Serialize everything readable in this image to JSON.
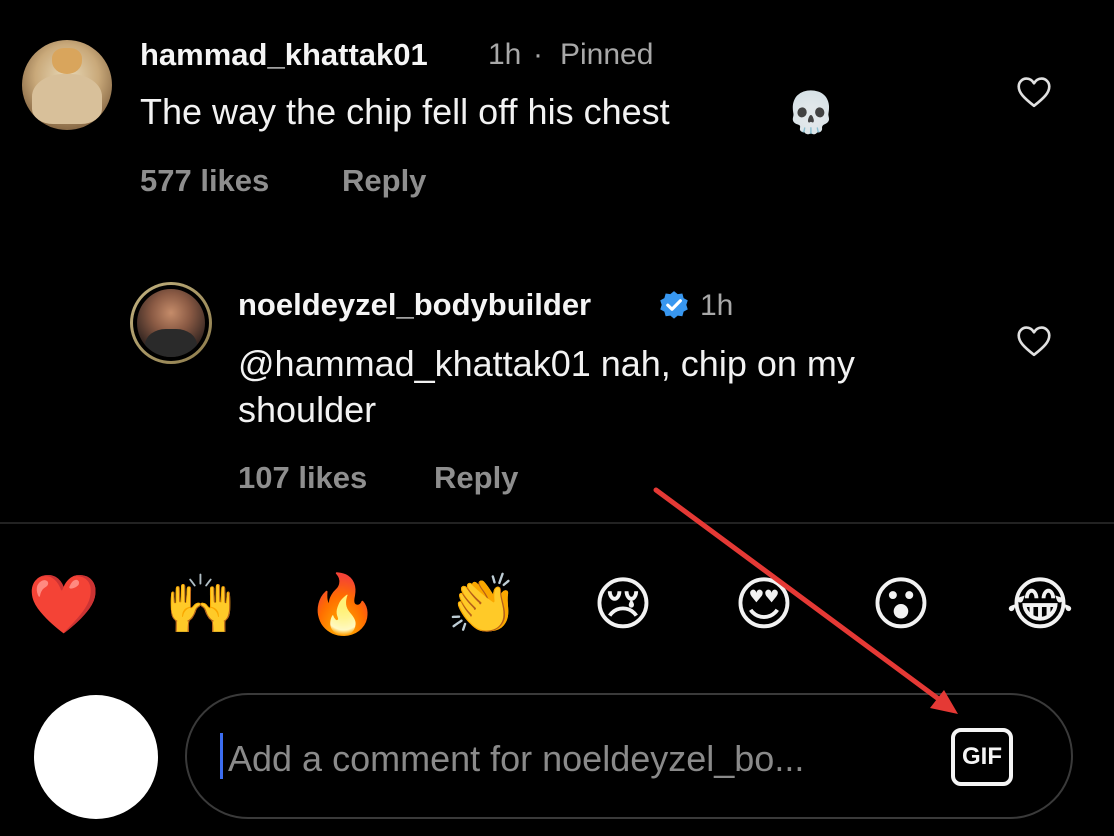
{
  "comments": [
    {
      "username": "hammad_khattak01",
      "time": "1h",
      "separator": "·",
      "pinned_label": "Pinned",
      "text": "The way the chip fell off his chest",
      "emoji": "💀",
      "likes": "577 likes",
      "reply_label": "Reply"
    },
    {
      "username": "noeldeyzel_bodybuilder",
      "verified": true,
      "time": "1h",
      "text_line1": "@hammad_khattak01 nah, chip on my",
      "text_line2": "shoulder",
      "likes": "107 likes",
      "reply_label": "Reply"
    }
  ],
  "reactions": [
    "❤️",
    "🙌",
    "🔥",
    "👏",
    "😢",
    "😍",
    "😮",
    "😂"
  ],
  "composer": {
    "placeholder": "Add a comment for noeldeyzel_bo...",
    "gif_label": "GIF"
  },
  "colors": {
    "background": "#000000",
    "verified_blue": "#3897f0",
    "annotation_arrow": "#e53935",
    "caret": "#3c6df0"
  }
}
